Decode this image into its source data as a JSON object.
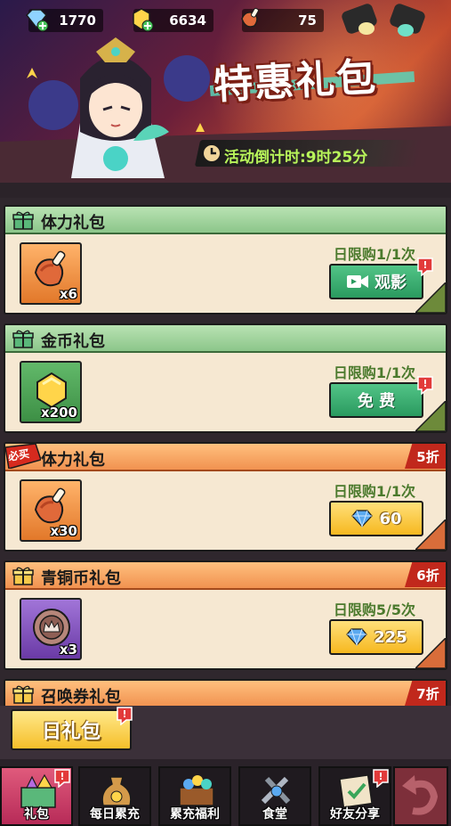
{
  "resources": [
    {
      "icon": "diamond-plus-icon",
      "value": "1770"
    },
    {
      "icon": "gold-coin-plus-icon",
      "value": "6634"
    },
    {
      "icon": "meat-icon",
      "value": "75"
    }
  ],
  "banner": {
    "title": "特惠礼包",
    "countdown": "活动倒计时:9时25分"
  },
  "packs": [
    {
      "title": "体力礼包",
      "theme": "green",
      "item_icon": "meat-icon",
      "item_color": "orange",
      "qty": "x6",
      "limit": "日限购1/1次",
      "button_label": "观影",
      "button_type": "video",
      "has_red_dot": true
    },
    {
      "title": "金币礼包",
      "theme": "green",
      "item_icon": "gold-coin-icon",
      "item_color": "green",
      "qty": "x200",
      "limit": "日限购1/1次",
      "button_label": "免 费",
      "button_type": "free",
      "has_red_dot": true
    },
    {
      "title": "体力礼包",
      "theme": "orange",
      "item_icon": "meat-icon",
      "item_color": "orange",
      "qty": "x30",
      "limit": "日限购1/1次",
      "button_label": "60",
      "button_type": "diamond",
      "discount": "5折",
      "must_buy": "必买"
    },
    {
      "title": "青铜币礼包",
      "theme": "orange",
      "item_icon": "bronze-coin-icon",
      "item_color": "purple",
      "qty": "x3",
      "limit": "日限购5/5次",
      "button_label": "225",
      "button_type": "diamond",
      "discount": "6折"
    },
    {
      "title": "召唤券礼包",
      "theme": "orange",
      "discount": "7折"
    }
  ],
  "daily_button": "日礼包",
  "nav": [
    {
      "label": "礼包",
      "icon": "gift-gems-icon",
      "active": true
    },
    {
      "label": "每日累充",
      "icon": "money-bag-icon",
      "active": false
    },
    {
      "label": "累充福利",
      "icon": "treasure-chest-icon",
      "active": false
    },
    {
      "label": "食堂",
      "icon": "cooking-tools-icon",
      "active": false
    },
    {
      "label": "好友分享",
      "icon": "share-book-icon",
      "active": false
    }
  ],
  "colors": {
    "green_header": "#8cc68a",
    "orange_header": "#f19250",
    "limit_text": "#4b7a2d",
    "countdown_text": "#b8f55a",
    "discount_badge": "#c1281c"
  }
}
